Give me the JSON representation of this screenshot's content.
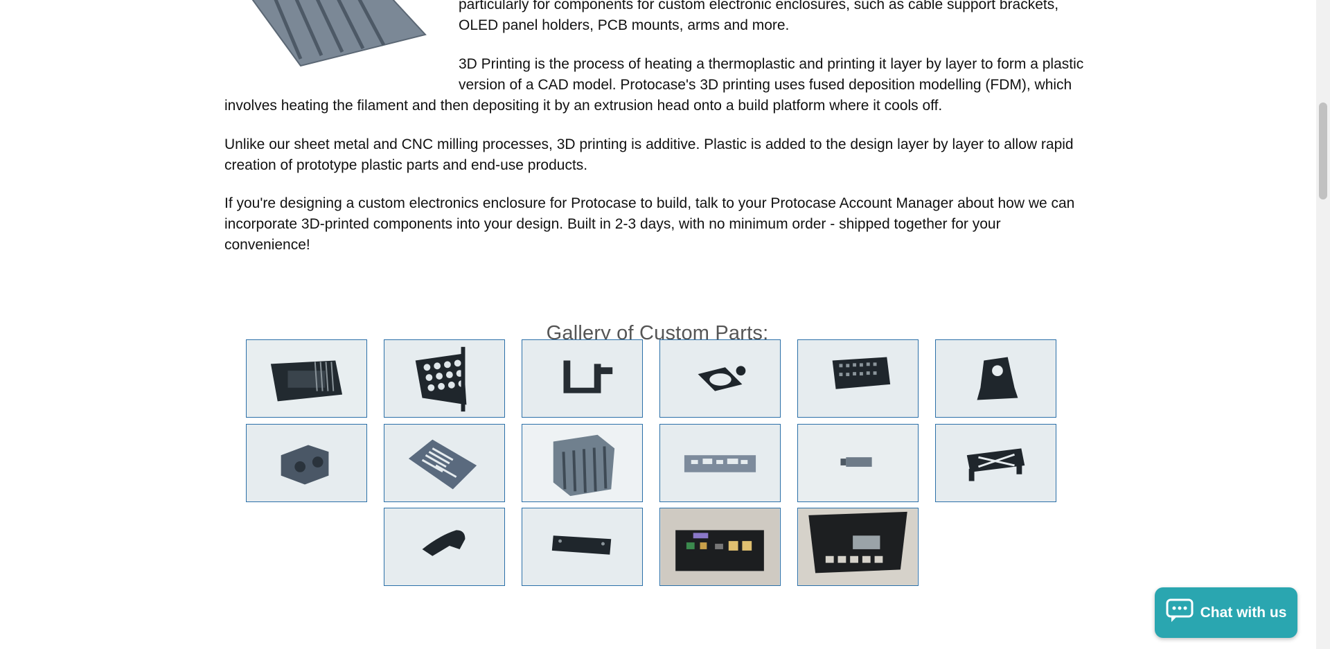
{
  "article": {
    "p1_lines": "particularly for components for custom electronic enclosures, such as cable support brackets, OLED panel holders, PCB mounts, arms and more.",
    "p2": "3D Printing is the process of heating a thermoplastic and printing it layer by layer to form a plastic version of a CAD model. Protocase's 3D printing uses fused deposition modelling (FDM), which",
    "p2_cont": "involves heating the filament and then depositing it by an extrusion head onto a build platform where it cools off.",
    "p3": "Unlike our sheet metal and CNC milling processes, 3D printing is additive. Plastic is added to the design layer by layer to allow rapid creation of prototype plastic parts and end-use products.",
    "p4": "If you're designing a custom electronics enclosure for Protocase to build, talk to your Protocase Account Manager about how we can incorporate 3D-printed components into your design. Built in 2-3 days, with no minimum order - shipped together for your convenience!"
  },
  "gallery": {
    "title": "Gallery of Custom Parts:"
  },
  "chat": {
    "label": "Chat with us",
    "icon": "chat-bubble-icon"
  },
  "colors": {
    "thumb_border": "#2a6fa8",
    "chat_bg": "#2aa6b0"
  }
}
